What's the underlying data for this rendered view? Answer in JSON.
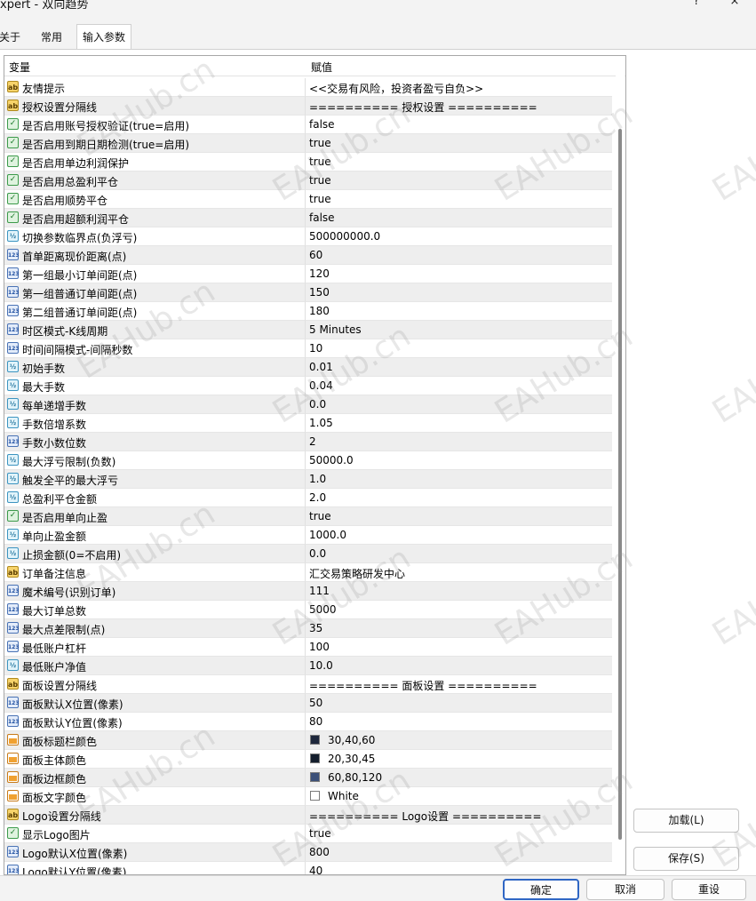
{
  "window": {
    "title": "xpert - 双向趋势",
    "help_label": "?",
    "close_label": "×"
  },
  "tabs": [
    {
      "label": "关于"
    },
    {
      "label": "常用"
    },
    {
      "label": "输入参数"
    }
  ],
  "grid": {
    "header": {
      "variable": "变量",
      "value": "赋值"
    },
    "rows": [
      {
        "type": "string",
        "name": "友情提示",
        "value": "<<交易有风险，投资者盈亏自负>>"
      },
      {
        "type": "string",
        "name": "授权设置分隔线",
        "value": "========== 授权设置 =========="
      },
      {
        "type": "bool",
        "name": "是否启用账号授权验证(true=启用)",
        "value": "false"
      },
      {
        "type": "bool",
        "name": "是否启用到期日期检测(true=启用)",
        "value": "true"
      },
      {
        "type": "bool",
        "name": "是否启用单边利润保护",
        "value": "true"
      },
      {
        "type": "bool",
        "name": "是否启用总盈利平仓",
        "value": "true"
      },
      {
        "type": "bool",
        "name": "是否启用顺势平仓",
        "value": "true"
      },
      {
        "type": "bool",
        "name": "是否启用超额利润平仓",
        "value": "false"
      },
      {
        "type": "double",
        "name": "切换参数临界点(负浮亏)",
        "value": "500000000.0"
      },
      {
        "type": "int",
        "name": "首单距离现价距离(点)",
        "value": "60"
      },
      {
        "type": "int",
        "name": "第一组最小订单间距(点)",
        "value": "120"
      },
      {
        "type": "int",
        "name": "第一组普通订单间距(点)",
        "value": "150"
      },
      {
        "type": "int",
        "name": "第二组普通订单间距(点)",
        "value": "180"
      },
      {
        "type": "int",
        "name": "时区模式-K线周期",
        "value": "5 Minutes"
      },
      {
        "type": "int",
        "name": "时间间隔模式-间隔秒数",
        "value": "10"
      },
      {
        "type": "double",
        "name": "初始手数",
        "value": "0.01"
      },
      {
        "type": "double",
        "name": "最大手数",
        "value": "0.04"
      },
      {
        "type": "double",
        "name": "每单递增手数",
        "value": "0.0"
      },
      {
        "type": "double",
        "name": "手数倍增系数",
        "value": "1.05"
      },
      {
        "type": "int",
        "name": "手数小数位数",
        "value": "2"
      },
      {
        "type": "double",
        "name": "最大浮亏限制(负数)",
        "value": "50000.0"
      },
      {
        "type": "double",
        "name": "触发全平的最大浮亏",
        "value": "1.0"
      },
      {
        "type": "double",
        "name": "总盈利平仓金额",
        "value": "2.0"
      },
      {
        "type": "bool",
        "name": "是否启用单向止盈",
        "value": "true"
      },
      {
        "type": "double",
        "name": "单向止盈金额",
        "value": "1000.0"
      },
      {
        "type": "double",
        "name": "止损金额(0=不启用)",
        "value": "0.0"
      },
      {
        "type": "string",
        "name": "订单备注信息",
        "value": "汇交易策略研发中心"
      },
      {
        "type": "int",
        "name": "魔术编号(识别订单)",
        "value": "111"
      },
      {
        "type": "int",
        "name": "最大订单总数",
        "value": "5000"
      },
      {
        "type": "int",
        "name": "最大点差限制(点)",
        "value": "35"
      },
      {
        "type": "int",
        "name": "最低账户杠杆",
        "value": "100"
      },
      {
        "type": "double",
        "name": "最低账户净值",
        "value": "10.0"
      },
      {
        "type": "string",
        "name": "面板设置分隔线",
        "value": "========== 面板设置 =========="
      },
      {
        "type": "int",
        "name": "面板默认X位置(像素)",
        "value": "50"
      },
      {
        "type": "int",
        "name": "面板默认Y位置(像素)",
        "value": "80"
      },
      {
        "type": "color",
        "name": "面板标题栏颜色",
        "value": "30,40,60",
        "swatch": "#1e283c"
      },
      {
        "type": "color",
        "name": "面板主体颜色",
        "value": "20,30,45",
        "swatch": "#141e2d"
      },
      {
        "type": "color",
        "name": "面板边框颜色",
        "value": "60,80,120",
        "swatch": "#3c5078"
      },
      {
        "type": "color",
        "name": "面板文字颜色",
        "value": "White",
        "swatch": "#ffffff"
      },
      {
        "type": "string",
        "name": "Logo设置分隔线",
        "value": "========== Logo设置 =========="
      },
      {
        "type": "bool",
        "name": "显示Logo图片",
        "value": "true"
      },
      {
        "type": "int",
        "name": "Logo默认X位置(像素)",
        "value": "800"
      },
      {
        "type": "int",
        "name": "Logo默认Y位置(像素)",
        "value": "40"
      }
    ]
  },
  "side_buttons": {
    "load": "加载(L)",
    "save": "保存(S)"
  },
  "footer_buttons": {
    "ok": "确定",
    "cancel": "取消",
    "reset": "重设"
  },
  "watermark": "EAHub.cn",
  "icon_labels": {
    "string": "ab",
    "bool": "✓",
    "int": "123",
    "double": "½",
    "color": ""
  }
}
